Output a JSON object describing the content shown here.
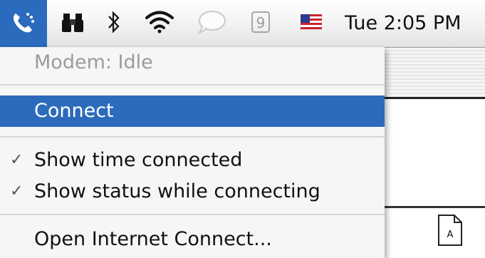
{
  "menubar": {
    "clock": "Tue 2:05 PM",
    "nine_glyph": "9",
    "extras": [
      {
        "name": "modem",
        "icon": "phone-modem-icon"
      },
      {
        "name": "sherlock",
        "icon": "binoculars-icon"
      },
      {
        "name": "bluetooth",
        "icon": "bluetooth-icon"
      },
      {
        "name": "airport",
        "icon": "wifi-icon"
      },
      {
        "name": "ichat",
        "icon": "speech-bubble-icon"
      },
      {
        "name": "nine",
        "icon": "nine-icon"
      },
      {
        "name": "input-menu",
        "icon": "us-flag-icon"
      }
    ]
  },
  "menu": {
    "status": "Modem: Idle",
    "connect": "Connect",
    "show_time": "Show time connected",
    "show_status": "Show status while connecting",
    "open_app": "Open Internet Connect...",
    "check_glyph": "✓"
  },
  "background": {
    "doc_letter": "A"
  },
  "colors": {
    "highlight": "#2c6bbb",
    "menubar_active": "#2a6bbd",
    "disabled_text": "#9c9c9c"
  }
}
